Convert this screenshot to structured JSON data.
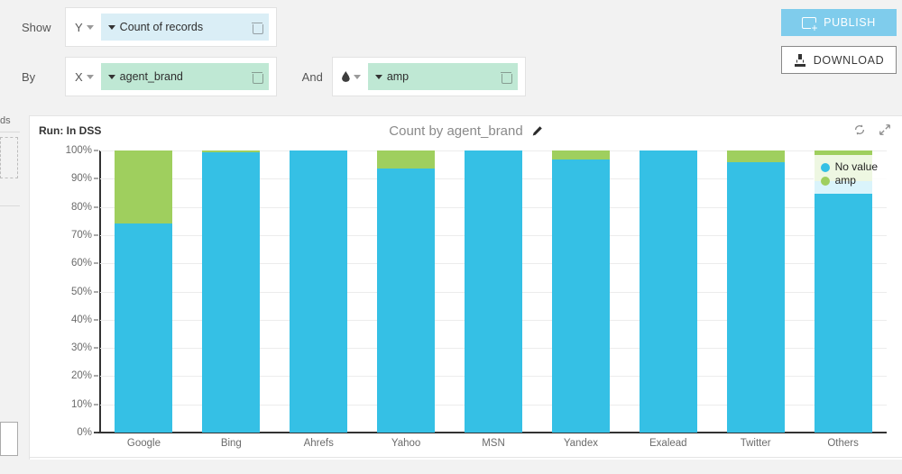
{
  "sidebar": {
    "clipped_label": "ds",
    "dropzone_name": "drop-zone"
  },
  "controls": {
    "show_label": "Show",
    "by_label": "By",
    "and_label": "And",
    "y_axis_selector": "Y",
    "x_axis_selector": "X",
    "color_selector_icon": "droplet-icon",
    "measure_pill": "Count of records",
    "dimension_pill": "agent_brand",
    "color_pill": "amp",
    "delete_icon": "trash-icon"
  },
  "actions": {
    "publish_label": "PUBLISH",
    "publish_icon": "publish-icon",
    "download_label": "DOWNLOAD",
    "download_icon": "download-icon"
  },
  "chart_header": {
    "run_label": "Run: In DSS",
    "title": "Count by agent_brand",
    "edit_icon": "pencil-icon",
    "refresh_icon": "refresh-icon",
    "expand_icon": "expand-icon"
  },
  "colors": {
    "series_no_value": "#35c0e5",
    "series_amp": "#9fcf5e",
    "publish_button": "#7fccec",
    "measure_pill_bg": "#daeef6",
    "dimension_pill_bg": "#bfe8d4",
    "page_bg": "#f2f2f2"
  },
  "chart_data": {
    "type": "bar",
    "stacked": true,
    "normalized": true,
    "title": "Count by agent_brand",
    "xlabel": "agent_brand",
    "ylabel": "",
    "ylim": [
      0,
      100
    ],
    "ytick_labels": [
      "0%",
      "10%",
      "20%",
      "30%",
      "40%",
      "50%",
      "60%",
      "70%",
      "80%",
      "90%",
      "100%"
    ],
    "ytick_values": [
      0,
      10,
      20,
      30,
      40,
      50,
      60,
      70,
      80,
      90,
      100
    ],
    "grid": true,
    "legend_position": "top-right",
    "categories": [
      "Google",
      "Bing",
      "Ahrefs",
      "Yahoo",
      "MSN",
      "Yandex",
      "Exalead",
      "Twitter",
      "Others"
    ],
    "series": [
      {
        "name": "No value",
        "color": "#35c0e5",
        "values": [
          74,
          99.3,
          100,
          93.5,
          100,
          96.8,
          100,
          95.7,
          89
        ]
      },
      {
        "name": "amp",
        "color": "#9fcf5e",
        "values": [
          26,
          0.7,
          0,
          6.5,
          0,
          3.2,
          0,
          4.3,
          11
        ]
      }
    ]
  },
  "legend": {
    "items": [
      {
        "label": "No value",
        "color": "#35c0e5"
      },
      {
        "label": "amp",
        "color": "#9fcf5e"
      }
    ]
  }
}
